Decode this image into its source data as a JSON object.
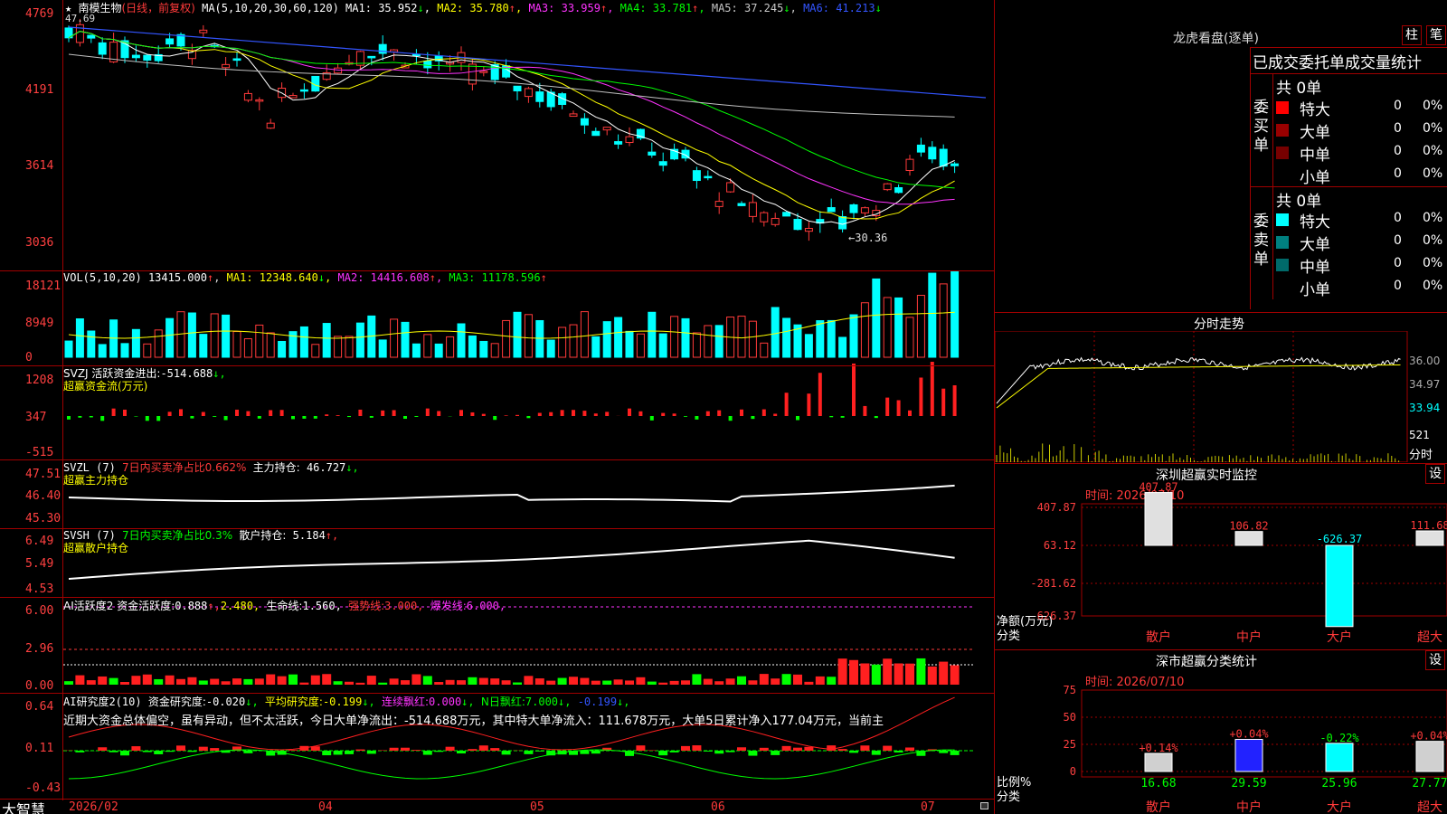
{
  "stock": {
    "name": "南模生物",
    "period": "(日线，前复权)",
    "ma_label": "MA(5,10,20,30,60,120)",
    "star": "★",
    "ma": [
      {
        "label": "MA1:",
        "value": "35.952",
        "arrow": "↓",
        "color": "#ffffff"
      },
      {
        "label": "MA2:",
        "value": "35.780",
        "arrow": "↑",
        "color": "#ffff00"
      },
      {
        "label": "MA3:",
        "value": "33.959",
        "arrow": "↑",
        "color": "#ff33ff"
      },
      {
        "label": "MA4:",
        "value": "33.781",
        "arrow": "↑",
        "color": "#00ff00"
      },
      {
        "label": "MA5:",
        "value": "37.245",
        "arrow": "↓",
        "color": "#c0c0c0"
      },
      {
        "label": "MA6:",
        "value": "41.213",
        "arrow": "↓",
        "color": "#3355ff"
      }
    ],
    "y_ticks": [
      "4769",
      "4191",
      "3614",
      "3036"
    ],
    "high_mark": "47.69",
    "low_mark": "←30.36"
  },
  "vol": {
    "label": "VOL(5,10,20)",
    "v": "13415.000",
    "v_arrow": "↑",
    "ma1": "MA1:",
    "ma1_v": "12348.640",
    "ma1_a": "↓",
    "ma2": "MA2:",
    "ma2_v": "14416.608",
    "ma2_a": "↑",
    "ma3": "MA3:",
    "ma3_v": "11178.596",
    "ma3_a": "↑",
    "y_ticks": [
      "18121",
      "8949",
      "0"
    ]
  },
  "svzj": {
    "label": "SVZJ  活跃资金进出:",
    "value": "-514.688",
    "arrow": "↓,",
    "sub": "超赢资金流(万元)",
    "y_ticks": [
      "1208",
      "347",
      "-515"
    ]
  },
  "svzl": {
    "label": "SVZL (7)",
    "ratio": "7日内买卖净占比0.662%",
    "hold_label": "主力持仓:",
    "hold": "46.727",
    "arrow": "↓,",
    "sub": "超赢主力持仓",
    "y_ticks": [
      "47.51",
      "46.40",
      "45.30"
    ]
  },
  "svsh": {
    "label": "SVSH (7)",
    "ratio": "7日内买卖净占比0.3%",
    "hold_label": "散户持仓:",
    "hold": "5.184",
    "arrow": "↑,",
    "sub": "超赢散户持仓",
    "y_ticks": [
      "6.49",
      "5.49",
      "4.53"
    ]
  },
  "ai1": {
    "label": "AI活跃度2 资金活跃度:",
    "v1": "0.888",
    "v1a": "↑,",
    "v2": "2.480,",
    "life": "生命线:",
    "life_v": "1.560,",
    "strong": "强势线:",
    "strong_v": "3.000,",
    "burst": "爆发线:",
    "burst_v": "6.000,",
    "y_ticks": [
      "6.00",
      "2.96",
      "0.00"
    ]
  },
  "ai2": {
    "label": "AI研究度2(10)",
    "res": "资金研究度:",
    "res_v": "-0.020",
    "res_a": "↓,",
    "avg": "平均研究度:",
    "avg_v": "-0.199",
    "avg_a": "↓,",
    "cont": "连续飘红:",
    "cont_v": "0.000",
    "cont_a": "↓,",
    "n": "N日飘红:",
    "n_v": "7.000",
    "n_a": "↓,",
    "last": "-0.199",
    "last_a": "↓,",
    "desc": "近期大资金总体偏空，虽有异动，但不太活跃，今日大单净流出：-514.688万元，其中特大单净流入：111.678万元，大单5日累计净入177.04万元，当前主",
    "y_ticks": [
      "0.64",
      "0.11",
      "-0.43"
    ]
  },
  "footer": {
    "brand": "大智慧",
    "months": [
      "2026/02",
      "04",
      "05",
      "06",
      "07"
    ]
  },
  "side": {
    "title": "龙虎看盘(逐单)",
    "btn1": "柱",
    "btn2": "笔",
    "stat_title": "已成交委托单成交量统计",
    "buy": {
      "cat": "委买单",
      "total": "共 0单",
      "rows": [
        {
          "name": "特大",
          "n": "0",
          "p": "0%",
          "c": "#ff0000"
        },
        {
          "name": "大单",
          "n": "0",
          "p": "0%",
          "c": "#990000"
        },
        {
          "name": "中单",
          "n": "0",
          "p": "0%",
          "c": "#770000"
        },
        {
          "name": "小单",
          "n": "0",
          "p": "0%",
          "c": "#000000"
        }
      ]
    },
    "sell": {
      "cat": "委卖单",
      "total": "共 0单",
      "rows": [
        {
          "name": "特大",
          "n": "0",
          "p": "0%",
          "c": "#00ffff"
        },
        {
          "name": "大单",
          "n": "0",
          "p": "0%",
          "c": "#008080"
        },
        {
          "name": "中单",
          "n": "0",
          "p": "0%",
          "c": "#006a6a"
        },
        {
          "name": "小单",
          "n": "0",
          "p": "0%",
          "c": "#000000"
        }
      ]
    },
    "mini": {
      "title": "分时走势",
      "y": [
        "36.00",
        "34.97",
        "33.94"
      ],
      "vol": "521",
      "vlabel": "分时"
    },
    "sz": {
      "title": "深圳超赢实时监控",
      "btn": "设",
      "time": "时间: 2026/07/10",
      "y": [
        "407.87",
        "63.12",
        "-281.62",
        "-626.37"
      ],
      "unit": "净额(万元)",
      "cat": "分类",
      "bars": [
        {
          "name": "散户",
          "v": "407.87"
        },
        {
          "name": "中户",
          "v": "106.82"
        },
        {
          "name": "大户",
          "v": "-626.37"
        },
        {
          "name": "超大",
          "v": "111.68"
        }
      ]
    },
    "cls": {
      "title": "深市超赢分类统计",
      "btn": "设",
      "time": "时间: 2026/07/10",
      "y": [
        "75",
        "50",
        "25",
        "0"
      ],
      "unit": "比例%",
      "cat": "分类",
      "bars": [
        {
          "name": "散户",
          "pct": "16.68",
          "chg": "+0.14%"
        },
        {
          "name": "中户",
          "pct": "29.59",
          "chg": "+0.04%"
        },
        {
          "name": "大户",
          "pct": "25.96",
          "chg": "-0.22%"
        },
        {
          "name": "超大",
          "pct": "27.77",
          "chg": "+0.04%"
        }
      ]
    }
  }
}
